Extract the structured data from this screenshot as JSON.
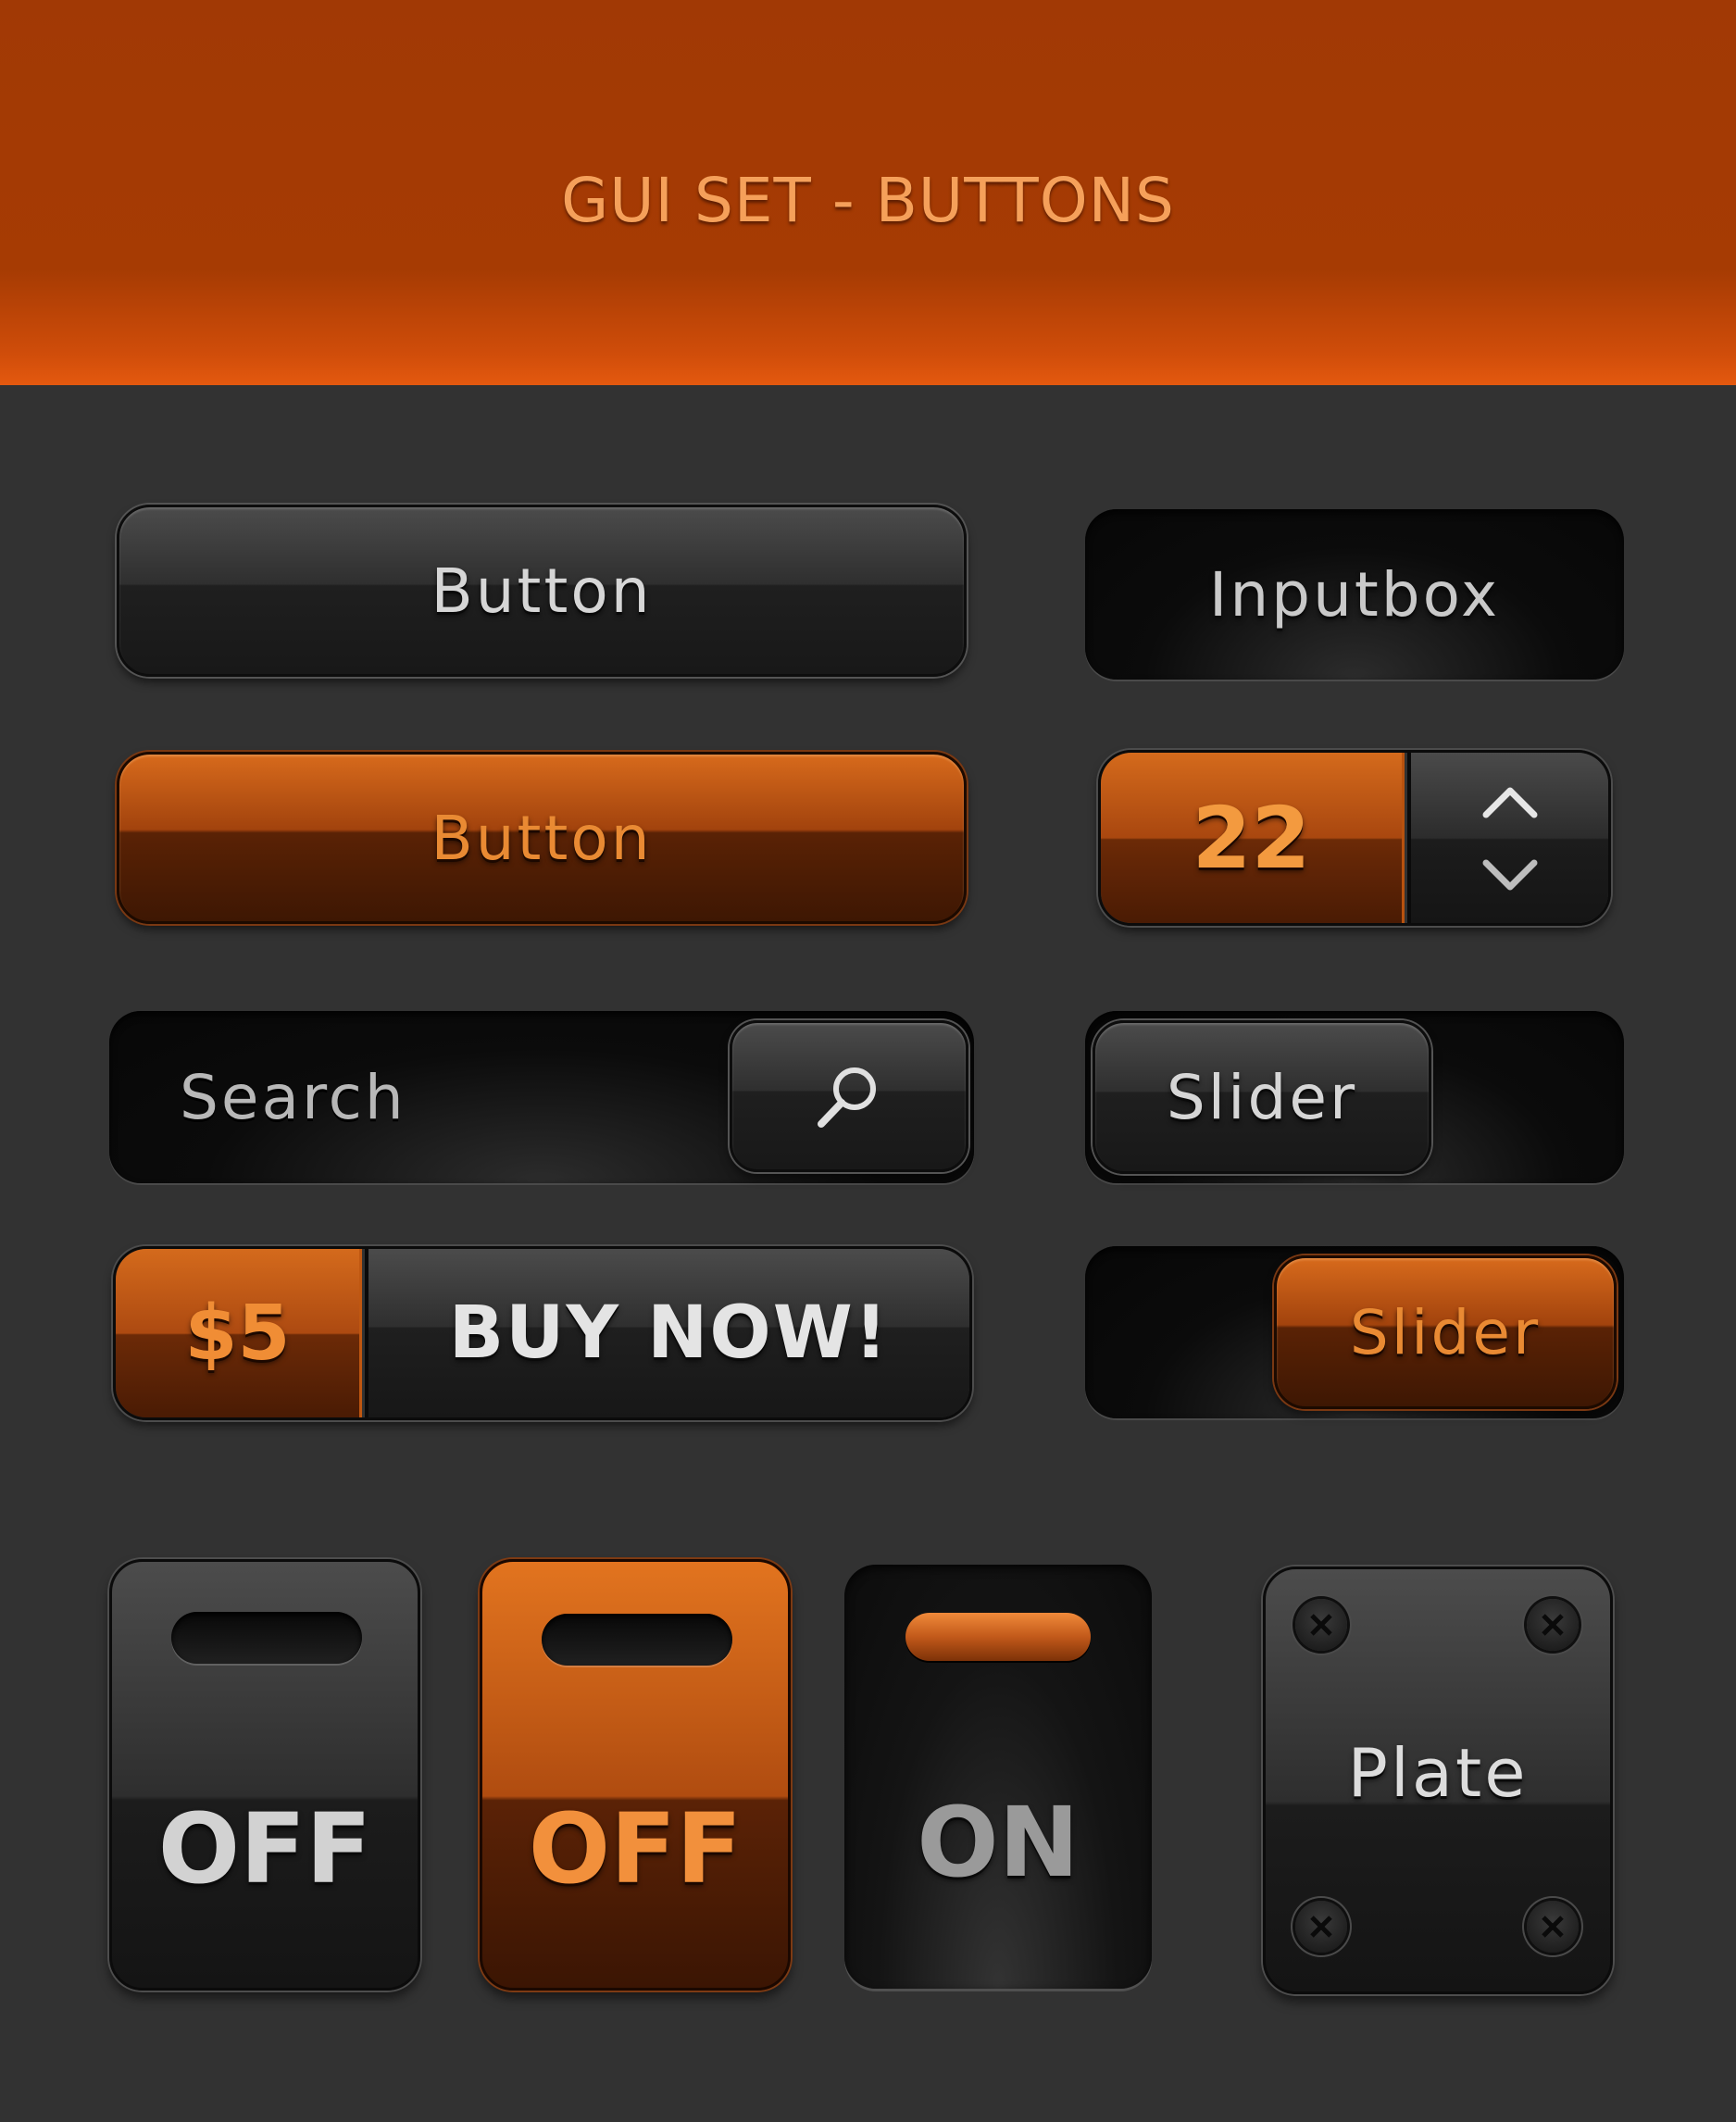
{
  "header": {
    "title": "GUI SET - BUTTONS"
  },
  "row1": {
    "button_label": "Button",
    "inputbox_label": "Inputbox"
  },
  "row2": {
    "button_label": "Button",
    "stepper_value": "22"
  },
  "row3": {
    "search_placeholder": "Search",
    "slider_label": "Slider"
  },
  "row4": {
    "price": "$5",
    "buy_label": "BUY NOW!",
    "slider_label": "Slider"
  },
  "toggles": {
    "dark_off_label": "OFF",
    "orange_off_label": "OFF",
    "on_label": "ON",
    "plate_label": "Plate"
  },
  "icons": {
    "search": "magnifier-icon",
    "up": "chevron-up-icon",
    "down": "chevron-down-icon",
    "screw": "screw-icon"
  },
  "colors": {
    "accent": "#e98a33",
    "header": "#a63b03",
    "background": "#323232"
  }
}
